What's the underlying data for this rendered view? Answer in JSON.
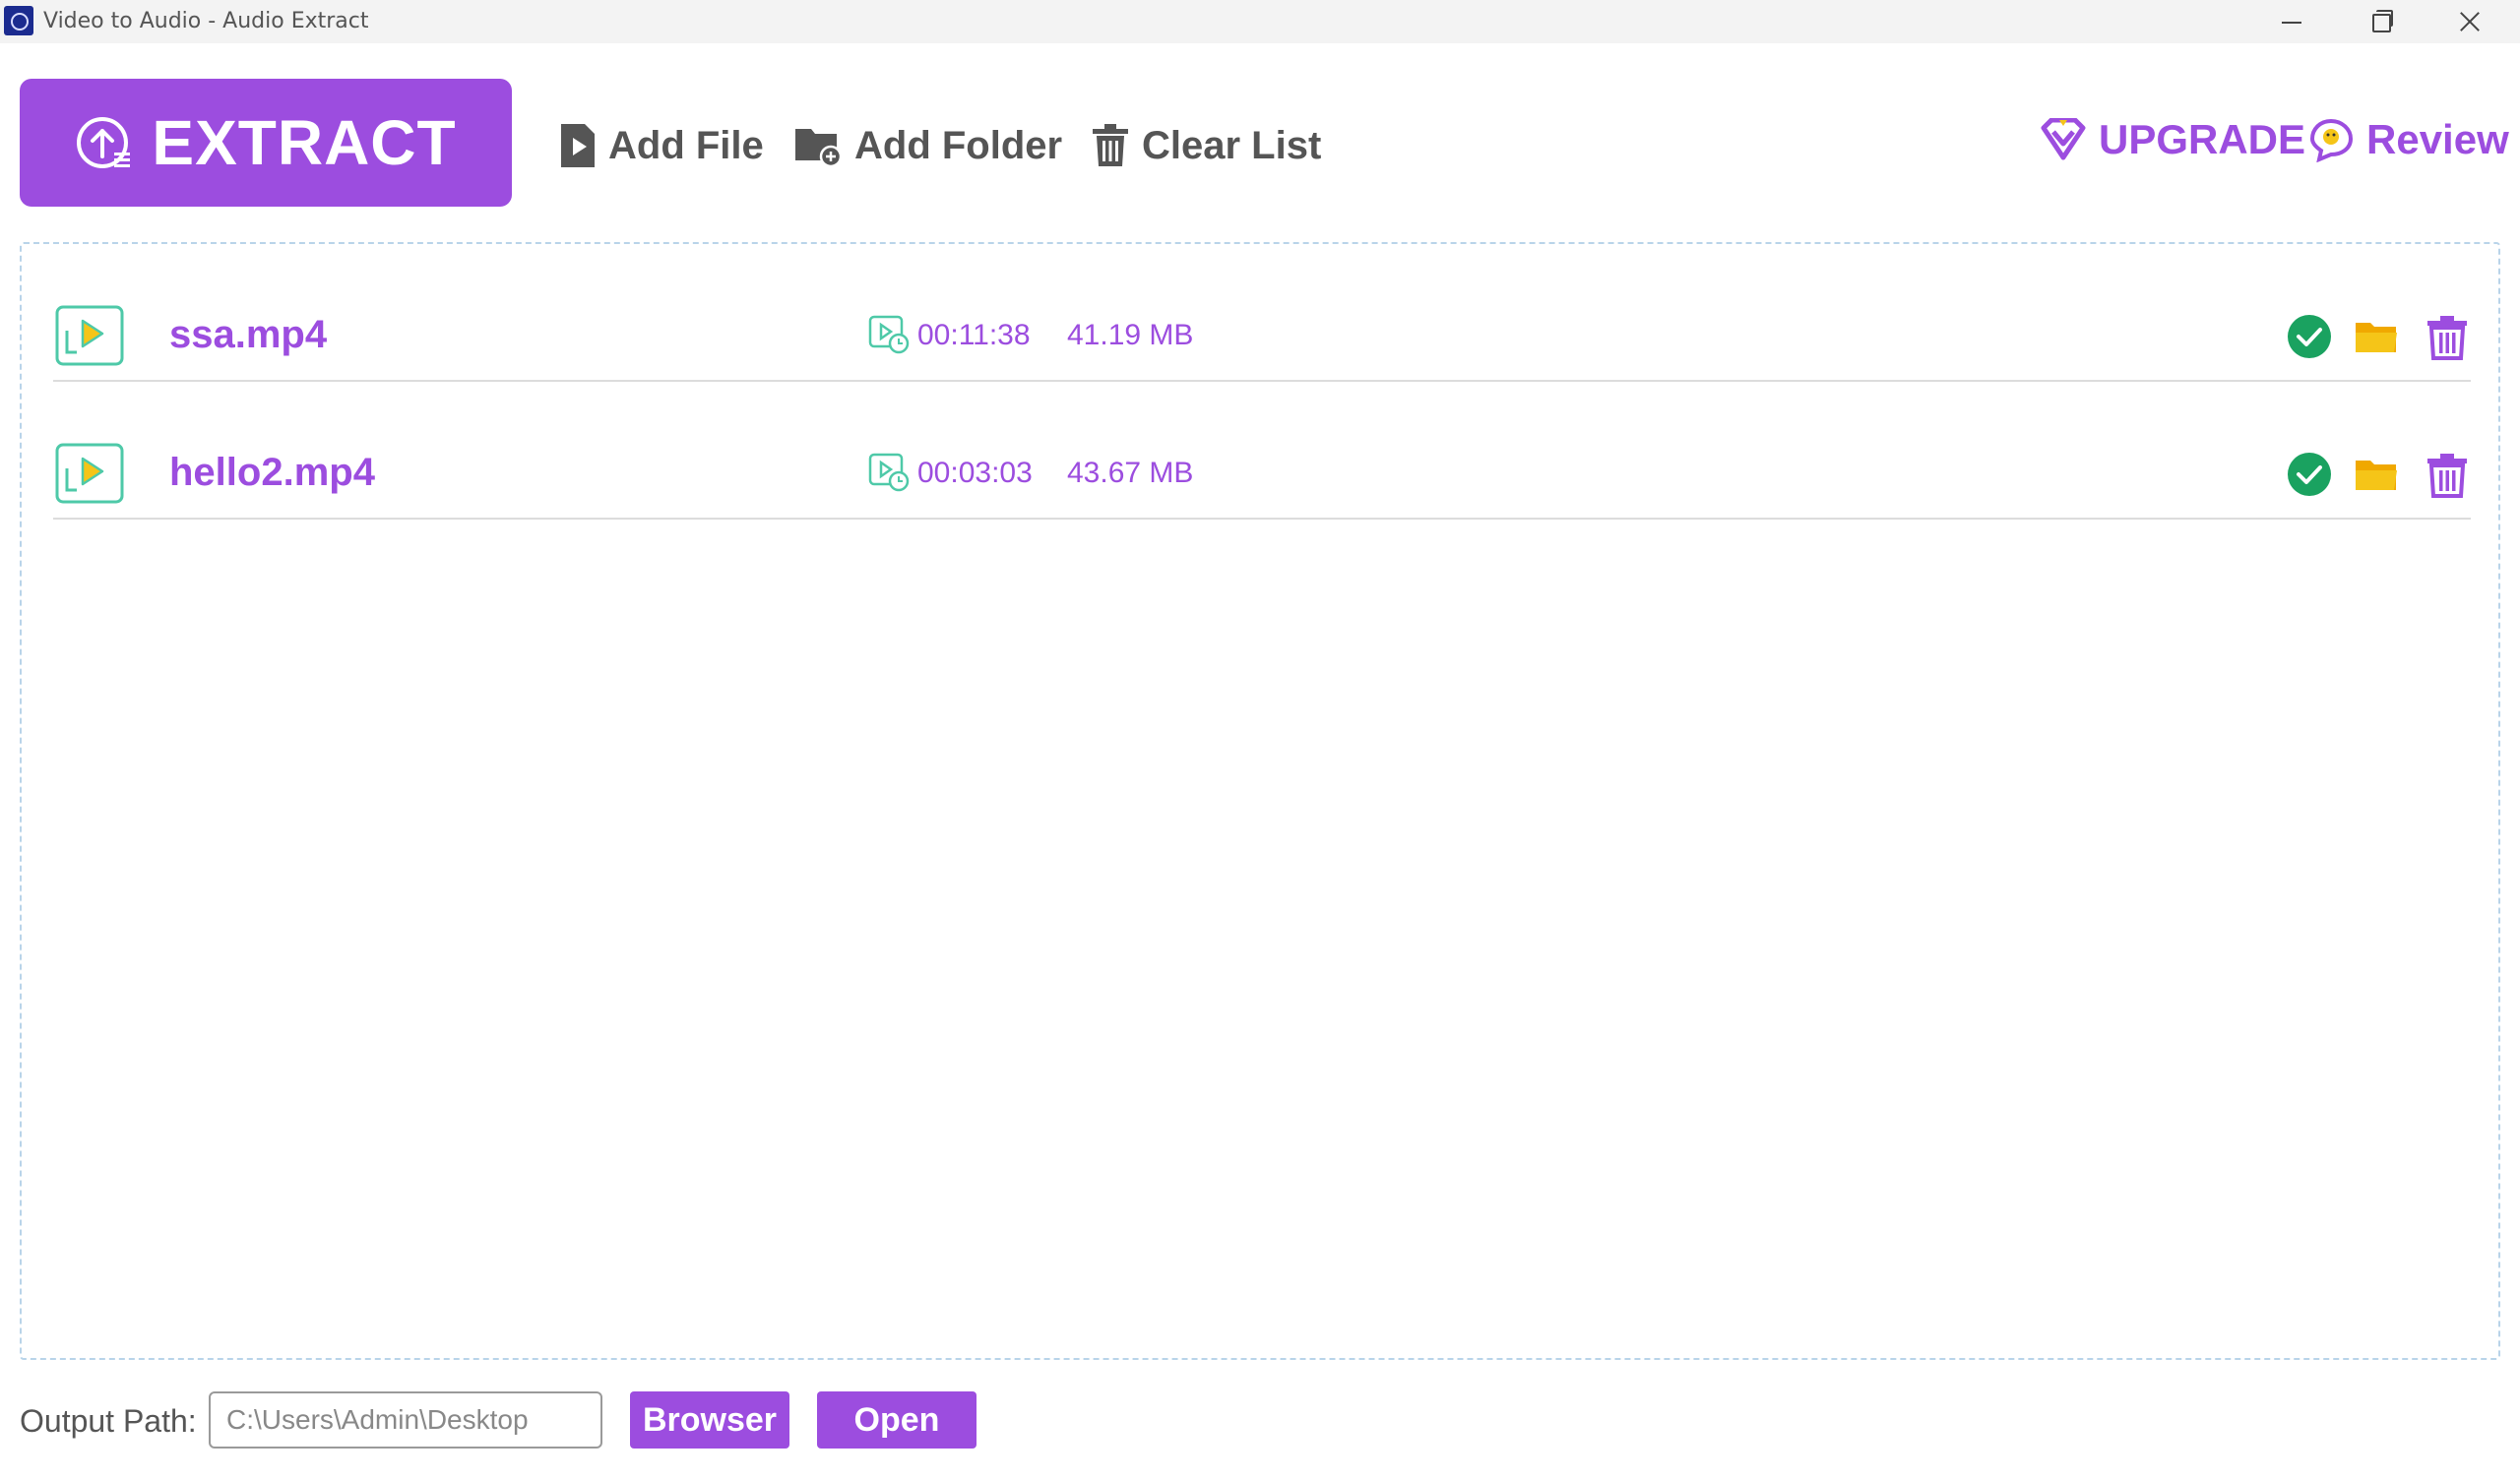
{
  "window": {
    "title": "Video to Audio - Audio Extract",
    "icon": "app-logo-icon"
  },
  "toolbar": {
    "extract_label": "EXTRACT",
    "add_file_label": "Add File",
    "add_folder_label": "Add Folder",
    "clear_list_label": "Clear List",
    "upgrade_label": "UPGRADE",
    "review_label": "Review"
  },
  "files": [
    {
      "name": "ssa.mp4",
      "duration": "00:11:38",
      "size": "41.19 MB",
      "status": "done"
    },
    {
      "name": "hello2.mp4",
      "duration": "00:03:03",
      "size": "43.67 MB",
      "status": "done"
    }
  ],
  "footer": {
    "output_label": "Output Path:",
    "output_path": "C:\\Users\\Admin\\Desktop",
    "browser_label": "Browser",
    "open_label": "Open"
  },
  "colors": {
    "accent": "#9c4ddf",
    "success": "#1aa260",
    "folder": "#f5c518",
    "teal": "#4ec9a8"
  }
}
